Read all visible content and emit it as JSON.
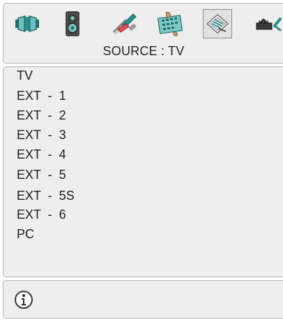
{
  "menu": {
    "icons": [
      {
        "name": "picture-icon"
      },
      {
        "name": "sound-icon"
      },
      {
        "name": "settings-icon"
      },
      {
        "name": "features-icon"
      },
      {
        "name": "install-icon"
      },
      {
        "name": "source-icon"
      }
    ],
    "selected": "install-icon"
  },
  "header": {
    "title": "SOURCE : TV"
  },
  "sources": {
    "items": [
      {
        "label": "TV"
      },
      {
        "label": "EXT  -  1"
      },
      {
        "label": "EXT  -  2"
      },
      {
        "label": "EXT  -  3"
      },
      {
        "label": "EXT  -  4"
      },
      {
        "label": "EXT  -  5"
      },
      {
        "label": "EXT  -  5S"
      },
      {
        "label": "EXT  -  6"
      },
      {
        "label": "PC"
      }
    ]
  },
  "footer": {
    "info_icon": "info-icon"
  },
  "colors": {
    "panel_bg": "#eeeeee",
    "panel_border": "#b4b4b4",
    "text": "#1c1c1c",
    "icon_teal": "#2a8e8a"
  }
}
